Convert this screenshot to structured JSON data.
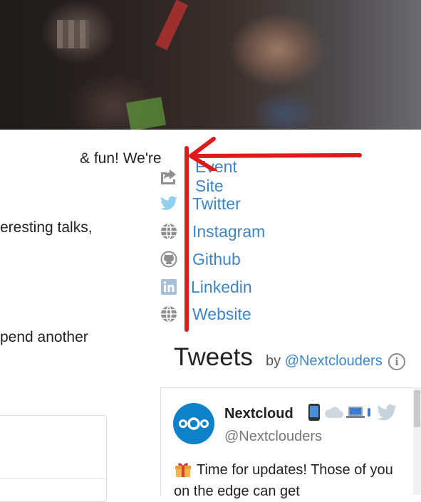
{
  "left_column": {
    "line1": "& fun! We're",
    "line2": "eresting talks,",
    "line3": "pend another"
  },
  "links": [
    {
      "label": "Event Site",
      "icon": "share-icon"
    },
    {
      "label": "Twitter",
      "icon": "twitter-icon"
    },
    {
      "label": "Instagram",
      "icon": "globe-icon"
    },
    {
      "label": "Github",
      "icon": "github-icon"
    },
    {
      "label": "Linkedin",
      "icon": "linkedin-icon"
    },
    {
      "label": "Website",
      "icon": "globe-icon"
    }
  ],
  "tweets": {
    "title": "Tweets",
    "by_prefix": "by",
    "by_handle": "@Nextclouders",
    "info_glyph": "i"
  },
  "tweet": {
    "name": "Nextcloud",
    "handle": "@Nextclouders",
    "text": "Time for updates! Those of you on the edge can get"
  },
  "colors": {
    "link": "#3f85c6",
    "annotation": "#e01a1a",
    "avatar": "#0d82c9"
  }
}
